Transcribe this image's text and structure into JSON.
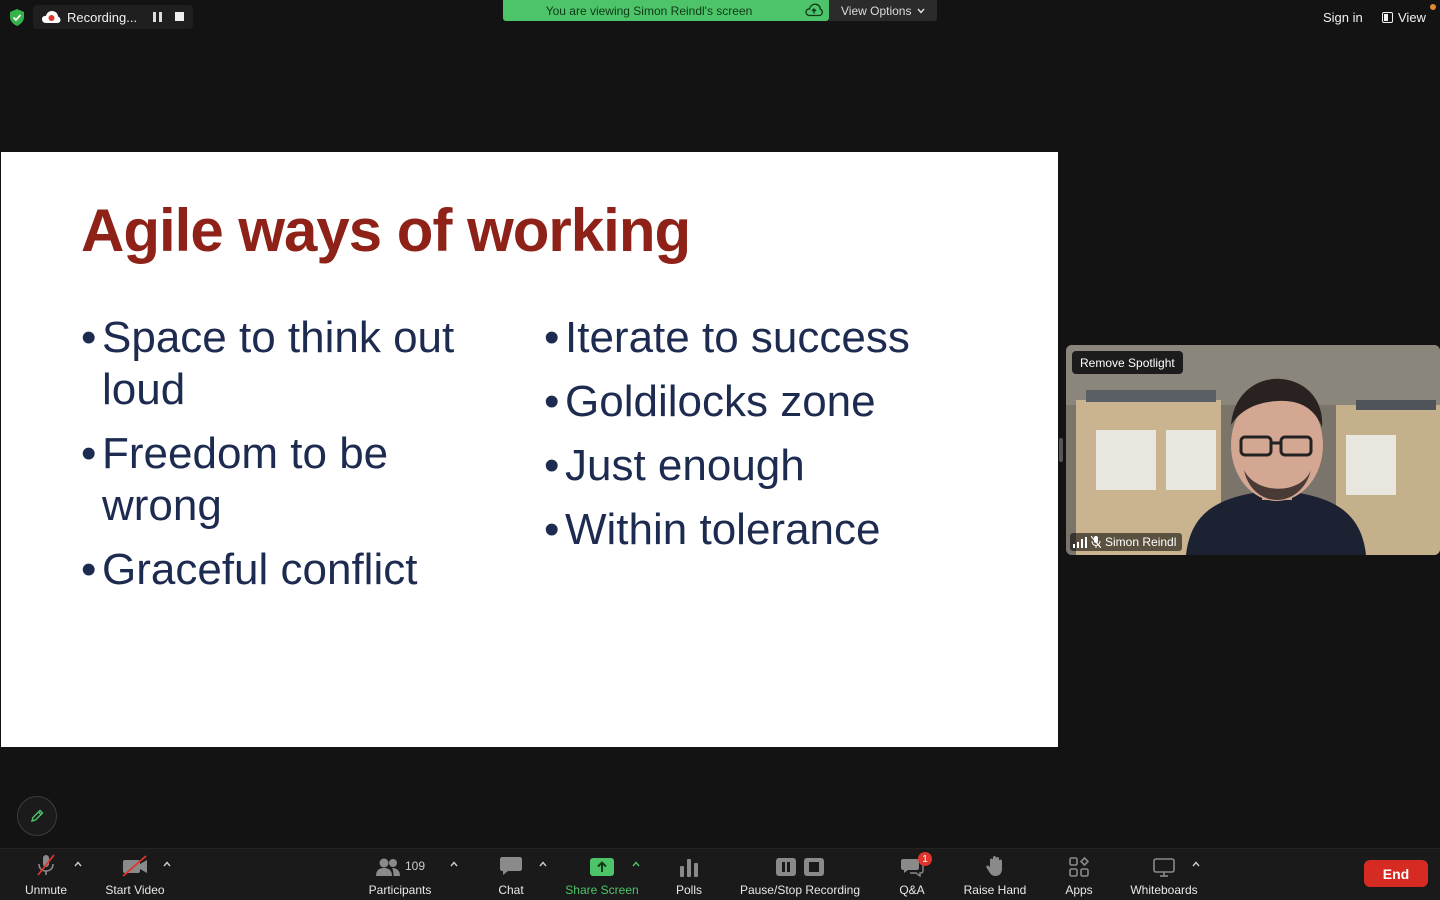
{
  "top_bar": {
    "recording_label": "Recording...",
    "viewing_banner": "You are viewing Simon Reindl's screen",
    "view_options_label": "View Options",
    "sign_in_label": "Sign in",
    "view_label": "View"
  },
  "slide": {
    "title": "Agile ways of working",
    "left_bullets": [
      "Space to think out loud",
      "Freedom to be wrong",
      "Graceful conflict"
    ],
    "right_bullets": [
      "Iterate to success",
      "Goldilocks zone",
      "Just enough",
      "Within tolerance"
    ]
  },
  "video": {
    "spotlight_label": "Remove Spotlight",
    "participant_name": "Simon Reindl"
  },
  "toolbar": {
    "unmute_label": "Unmute",
    "start_video_label": "Start Video",
    "participants_label": "Participants",
    "participants_count": "109",
    "chat_label": "Chat",
    "share_screen_label": "Share Screen",
    "polls_label": "Polls",
    "pause_stop_label": "Pause/Stop Recording",
    "qa_label": "Q&A",
    "qa_badge": "1",
    "raise_hand_label": "Raise Hand",
    "apps_label": "Apps",
    "whiteboards_label": "Whiteboards",
    "end_label": "End"
  },
  "colors": {
    "banner_green": "#4ec46a",
    "title_red": "#8e2218",
    "bullet_navy": "#1e2b50",
    "end_red": "#d52b23"
  }
}
